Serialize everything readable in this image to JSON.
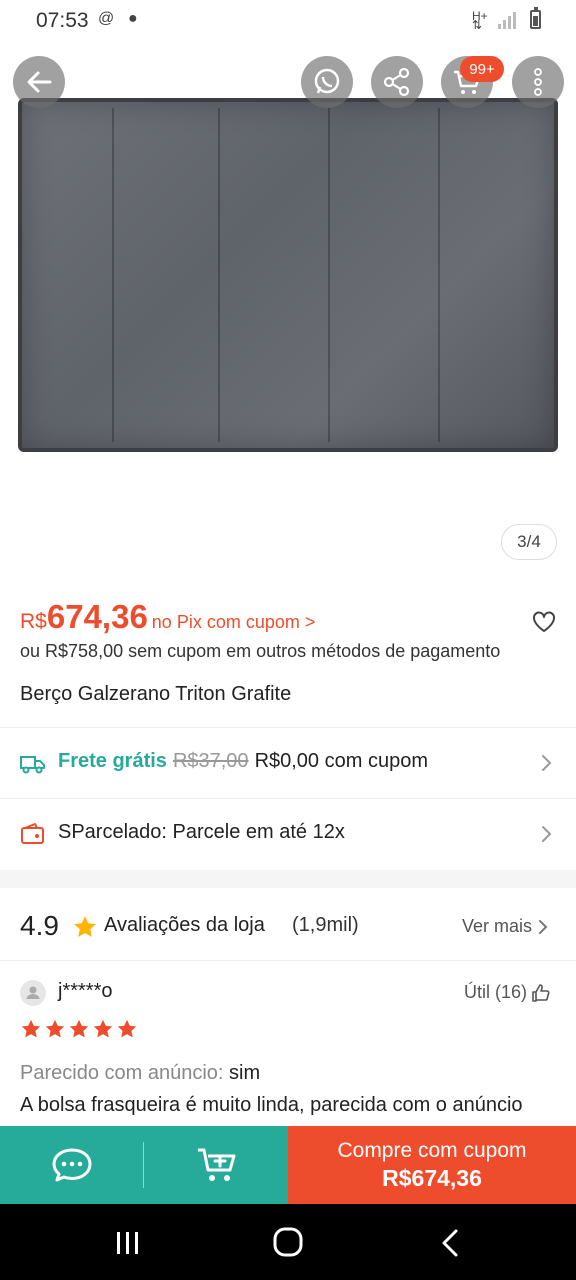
{
  "status_bar": {
    "time": "07:53"
  },
  "gallery": {
    "counter": "3/4"
  },
  "header": {
    "cart_badge": "99+"
  },
  "price": {
    "currency": "R$",
    "value": "674,36",
    "pix_note": "no Pix com cupom >",
    "alternative": "ou R$758,00 sem cupom em outros métodos de pagamento"
  },
  "product": {
    "title": "Berço Galzerano Triton Grafite"
  },
  "shipping": {
    "label": "Frete grátis",
    "old_price": "R$37,00",
    "new_price": "R$0,00 com cupom"
  },
  "installments": {
    "label": "SParcelado: Parcele em até 12x"
  },
  "store_rating": {
    "score": "4.9",
    "label": "Avaliações da loja",
    "count": "(1,9mil)",
    "see_more": "Ver mais"
  },
  "review": {
    "reviewer": "j*****o",
    "useful": "Útil (16)",
    "rating": 5,
    "similar_label": "Parecido com anúncio:",
    "similar_value": "sim",
    "text": "A bolsa frasqueira é muito linda, parecida com o anúncio"
  },
  "bottom_bar": {
    "buy_label": "Compre com cupom",
    "buy_price": "R$674,36"
  },
  "colors": {
    "brand_orange": "#ee4d2d",
    "teal": "#26aa99"
  }
}
